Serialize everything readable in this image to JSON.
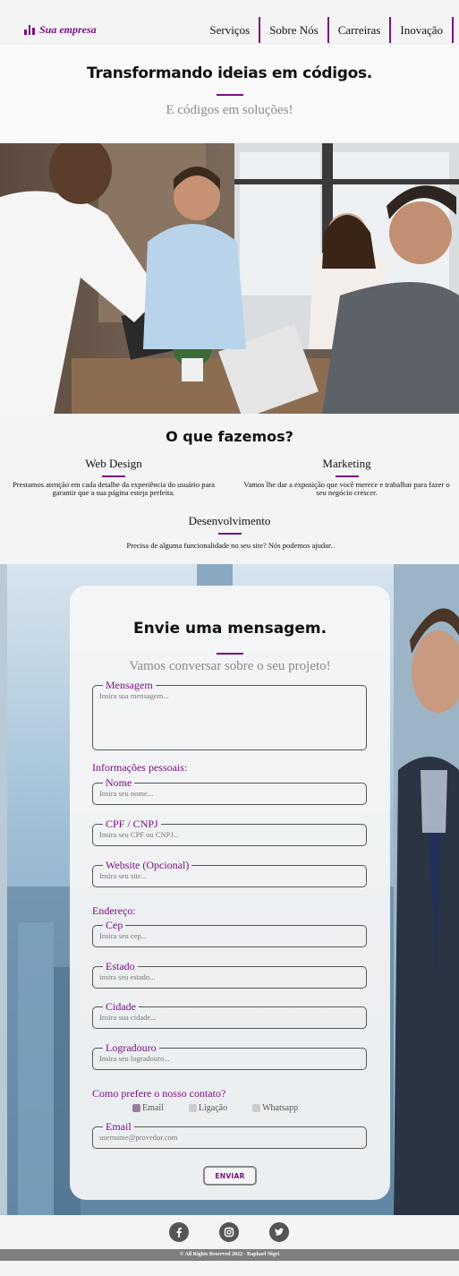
{
  "brand": {
    "name": "Sua empresa",
    "icon": "bar-chart-icon"
  },
  "nav": {
    "items": [
      "Serviços",
      "Sobre Nós",
      "Carreiras",
      "Inovação"
    ]
  },
  "hero": {
    "title": "Transformando ideias em códigos.",
    "subtitle": "E códigos em soluções!"
  },
  "services": {
    "title": "O que fazemos?",
    "items": [
      {
        "name": "Web Design",
        "desc": "Prestamos atenção em cada detalhe da experiência do usuário para garantir que a sua página esteja perfeita."
      },
      {
        "name": "Marketing",
        "desc": "Vamos lhe dar a exposição que você merece e trabalhar para fazer o seu negócio crescer."
      },
      {
        "name": "Desenvolvimento",
        "desc": "Precisa de alguma funcionalidade no seu site? Nós podemos ajudar."
      }
    ]
  },
  "contact": {
    "title": "Envie uma mensagem.",
    "subtitle": "Vamos conversar sobre o seu projeto!",
    "message": {
      "label": "Mensagem",
      "placeholder": "Insira sua mensagem..."
    },
    "personal_label": "Informações pessoais:",
    "name": {
      "label": "Nome",
      "placeholder": "Insira seu nome..."
    },
    "doc": {
      "label": "CPF / CNPJ",
      "placeholder": "Insira seu CPF ou CNPJ..."
    },
    "website": {
      "label": "Website (Opcional)",
      "placeholder": "Insira seu site..."
    },
    "address_label": "Endereço:",
    "cep": {
      "label": "Cep",
      "placeholder": "Insira seu cep..."
    },
    "state": {
      "label": "Estado",
      "placeholder": "insira seu estado..."
    },
    "city": {
      "label": "Cidade",
      "placeholder": "Insira sua cidade..."
    },
    "street": {
      "label": "Logradouro",
      "placeholder": "Insira seu logradouro..."
    },
    "pref_label": "Como prefere o nosso contato?",
    "prefs": [
      {
        "label": "Email",
        "checked": true
      },
      {
        "label": "Ligação",
        "checked": false
      },
      {
        "label": "Whatsapp",
        "checked": false
      }
    ],
    "email": {
      "label": "Email",
      "placeholder": "username@provedor.com"
    },
    "send_label": "ENVIAR"
  },
  "footer": {
    "socials": [
      "facebook-icon",
      "instagram-icon",
      "twitter-icon"
    ],
    "copyright": "All Rights Reserved 2022 - Raphael Nigri"
  },
  "colors": {
    "accent": "#7a1180",
    "footer_bar": "#7e7e7e"
  }
}
